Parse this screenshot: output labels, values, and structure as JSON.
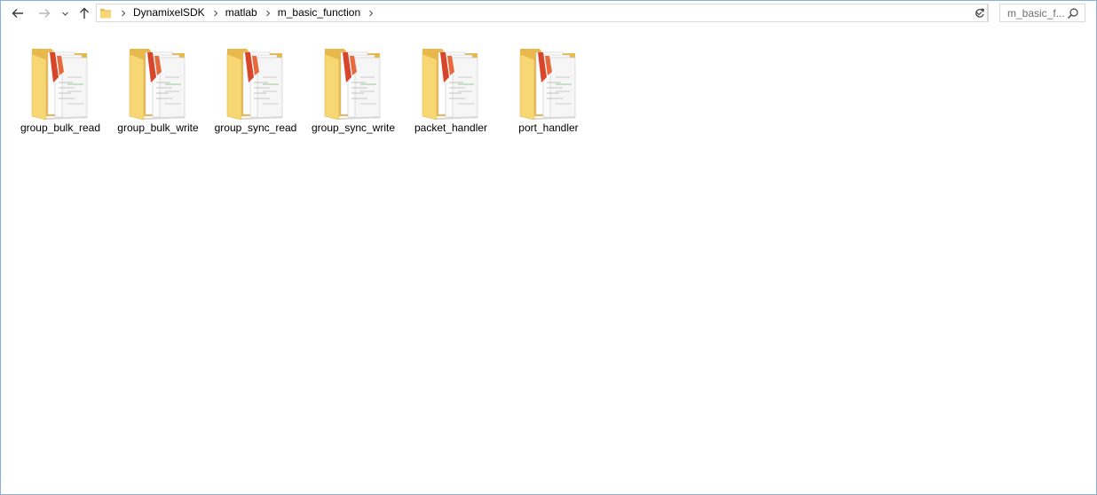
{
  "navigation": {
    "back_label": "←",
    "forward_label": "→",
    "recent_label": "⌄",
    "up_label": "↑"
  },
  "address": {
    "crumbs": [
      {
        "label": "DynamixelSDK"
      },
      {
        "label": "matlab"
      },
      {
        "label": "m_basic_function"
      }
    ]
  },
  "search": {
    "placeholder": "m_basic_f..."
  },
  "folders": [
    {
      "name": "group_bulk_read",
      "icon": "folder-with-documents-icon"
    },
    {
      "name": "group_bulk_write",
      "icon": "folder-with-documents-icon"
    },
    {
      "name": "group_sync_read",
      "icon": "folder-with-documents-icon"
    },
    {
      "name": "group_sync_write",
      "icon": "folder-with-documents-icon"
    },
    {
      "name": "packet_handler",
      "icon": "folder-with-documents-icon"
    },
    {
      "name": "port_handler",
      "icon": "folder-with-documents-icon"
    }
  ],
  "colors": {
    "folder_back": "#e8b84a",
    "folder_front": "#f7d774",
    "window_border": "#8ab0d6",
    "accent_red": "#d9452b"
  }
}
